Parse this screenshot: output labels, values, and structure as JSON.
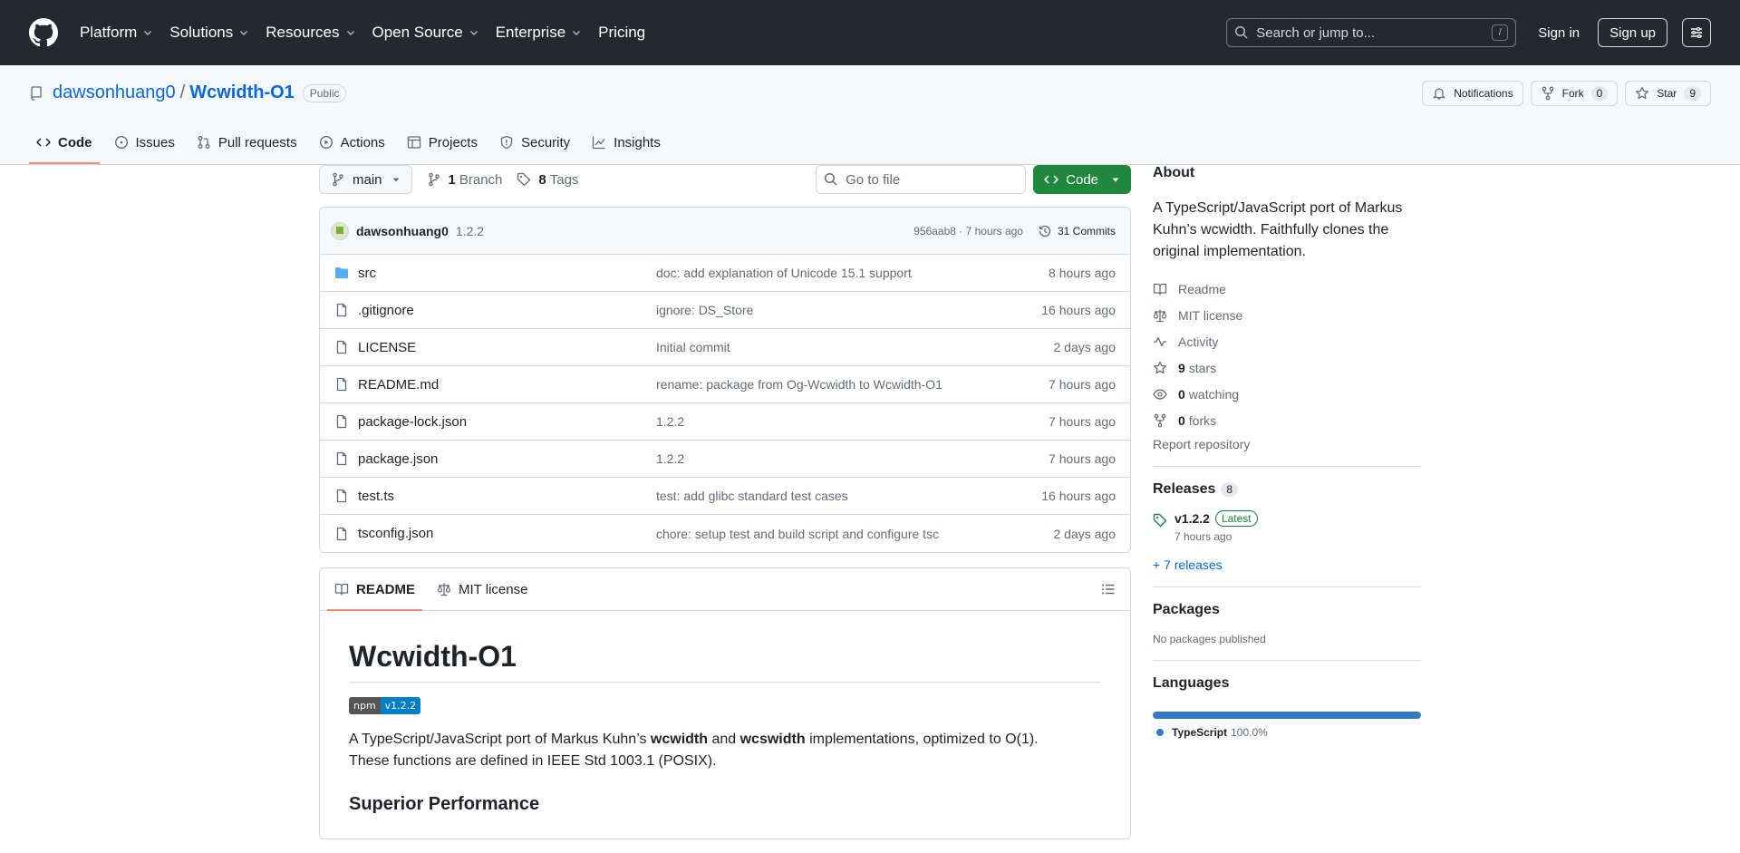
{
  "header": {
    "nav": [
      "Platform",
      "Solutions",
      "Resources",
      "Open Source",
      "Enterprise",
      "Pricing"
    ],
    "search_placeholder": "Search or jump to...",
    "search_key": "/",
    "sign_in": "Sign in",
    "sign_up": "Sign up"
  },
  "repo": {
    "owner": "dawsonhuang0",
    "slash": "/",
    "name": "Wcwidth-O1",
    "visibility": "Public",
    "notifications": "Notifications",
    "fork_label": "Fork",
    "fork_count": "0",
    "star_label": "Star",
    "star_count": "9"
  },
  "tabs": [
    "Code",
    "Issues",
    "Pull requests",
    "Actions",
    "Projects",
    "Security",
    "Insights"
  ],
  "toolbar": {
    "branch": "main",
    "branch_count": "1",
    "branch_label": "Branch",
    "tag_count": "8",
    "tag_label": "Tags",
    "goto_placeholder": "Go to file",
    "code_button": "Code"
  },
  "commit": {
    "author": "dawsonhuang0",
    "message": "1.2.2",
    "hash_time": "956aab8 · 7 hours ago",
    "commits": "31 Commits"
  },
  "files": [
    {
      "name": "src",
      "type": "dir",
      "message": "doc: add explanation of Unicode 15.1 support",
      "time": "8 hours ago"
    },
    {
      "name": ".gitignore",
      "type": "file",
      "message": "ignore: DS_Store",
      "time": "16 hours ago"
    },
    {
      "name": "LICENSE",
      "type": "file",
      "message": "Initial commit",
      "time": "2 days ago"
    },
    {
      "name": "README.md",
      "type": "file",
      "message": "rename: package from Og-Wcwidth to Wcwidth-O1",
      "time": "7 hours ago"
    },
    {
      "name": "package-lock.json",
      "type": "file",
      "message": "1.2.2",
      "time": "7 hours ago"
    },
    {
      "name": "package.json",
      "type": "file",
      "message": "1.2.2",
      "time": "7 hours ago"
    },
    {
      "name": "test.ts",
      "type": "file",
      "message": "test: add glibc standard test cases",
      "time": "16 hours ago"
    },
    {
      "name": "tsconfig.json",
      "type": "file",
      "message": "chore: setup test and build script and configure tsc",
      "time": "2 days ago"
    }
  ],
  "readme": {
    "tab_readme": "README",
    "tab_license": "MIT license",
    "title": "Wcwidth-O1",
    "npm_left": "npm",
    "npm_right": "v1.2.2",
    "p1_a": "A TypeScript/JavaScript port of Markus Kuhn’s ",
    "p1_b": "wcwidth",
    "p1_c": " and ",
    "p1_d": "wcswidth",
    "p1_e": " implementations, optimized to O(1).",
    "p1_f": "These functions are defined in IEEE Std 1003.1 (POSIX).",
    "h2": "Superior Performance"
  },
  "sidebar": {
    "about_title": "About",
    "description": "A TypeScript/JavaScript port of Markus Kuhn’s wcwidth. Faithfully clones the original implementation.",
    "readme": "Readme",
    "license": "MIT license",
    "activity": "Activity",
    "stars_n": "9",
    "stars": "stars",
    "watching_n": "0",
    "watching": "watching",
    "forks_n": "0",
    "forks": "forks",
    "report": "Report repository",
    "releases_title": "Releases",
    "releases_count": "8",
    "release_name": "v1.2.2",
    "release_badge": "Latest",
    "release_time": "7 hours ago",
    "more_releases": "+ 7 releases",
    "packages_title": "Packages",
    "no_packages": "No packages published",
    "languages_title": "Languages",
    "language": "TypeScript",
    "language_pct": "100.0%"
  },
  "colors": {
    "header_bg": "#24292f",
    "accent_link": "#0969da",
    "code_button": "#1f883d",
    "active_tab": "#fd8c73",
    "typescript": "#3178c6"
  }
}
